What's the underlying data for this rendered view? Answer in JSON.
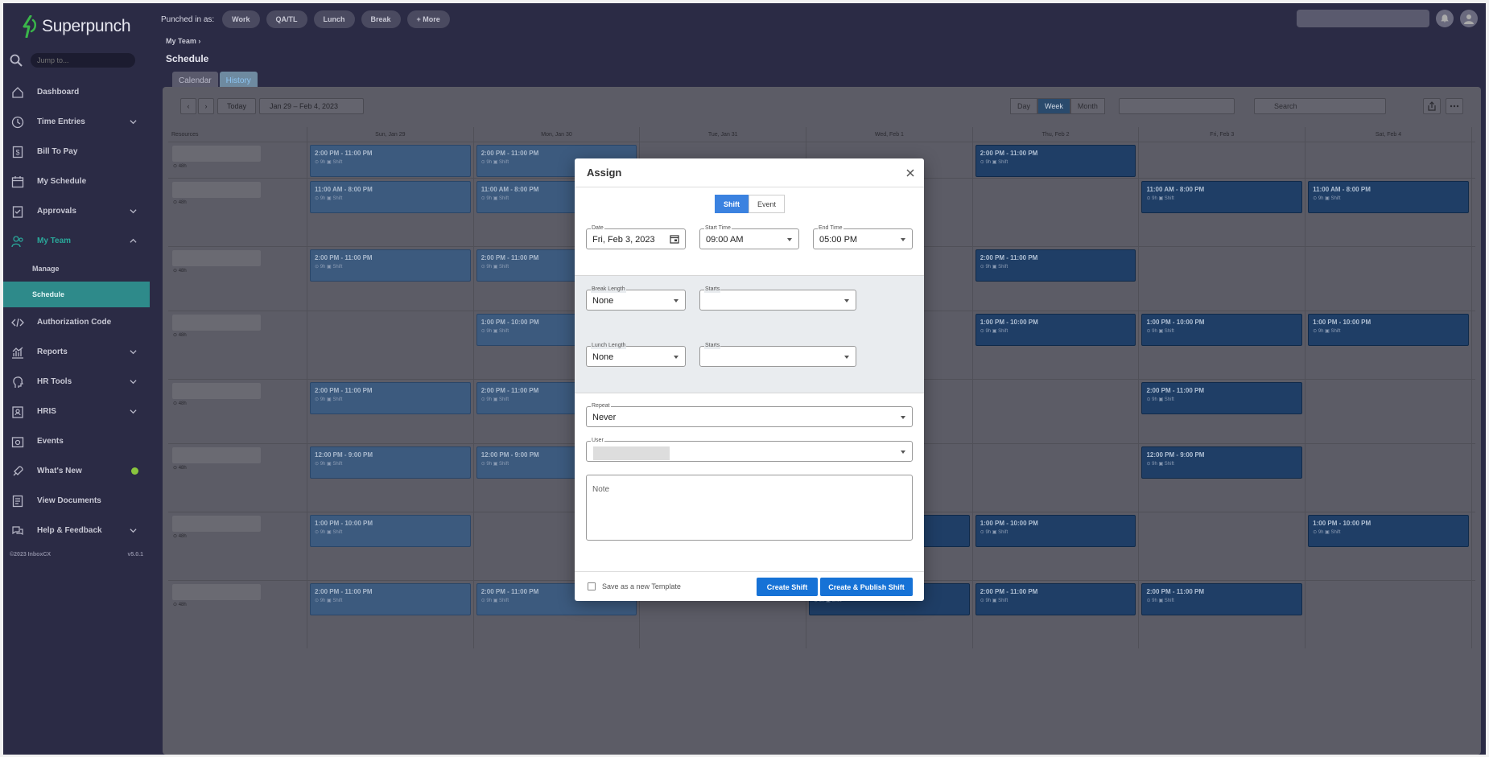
{
  "app": {
    "name": "Superpunch",
    "jump_placeholder": "Jump to..."
  },
  "nav": {
    "items": [
      {
        "label": "Dashboard"
      },
      {
        "label": "Time Entries"
      },
      {
        "label": "Bill To Pay"
      },
      {
        "label": "My Schedule"
      },
      {
        "label": "Approvals"
      },
      {
        "label": "My Team"
      },
      {
        "label": "Authorization Code"
      },
      {
        "label": "Reports"
      },
      {
        "label": "HR Tools"
      },
      {
        "label": "HRIS"
      },
      {
        "label": "Events"
      },
      {
        "label": "What's New"
      },
      {
        "label": "View Documents"
      },
      {
        "label": "Help & Feedback"
      }
    ],
    "subitems": [
      {
        "label": "Manage"
      },
      {
        "label": "Schedule"
      }
    ],
    "footer_copy": "©2023 InboxCX",
    "footer_version": "v5.0.1"
  },
  "topbar": {
    "punched_label": "Punched in as:",
    "pills": [
      "Work",
      "QA/TL",
      "Lunch",
      "Break",
      "+ More"
    ]
  },
  "page": {
    "breadcrumb": "My Team",
    "breadcrumb_sep": "›",
    "title": "Schedule",
    "tabs": [
      "Calendar",
      "History"
    ]
  },
  "toolbar": {
    "prev": "‹",
    "next": "›",
    "today": "Today",
    "range": "Jan 29 – Feb 4, 2023",
    "views": [
      "Day",
      "Week",
      "Month"
    ],
    "search_placeholder": "Search"
  },
  "grid": {
    "resources_label": "Resources",
    "days": [
      "Sun, Jan 29",
      "Mon, Jan 30",
      "Tue, Jan 31",
      "Wed, Feb 1",
      "Thu, Feb 2",
      "Fri, Feb 3",
      "Sat, Feb 4"
    ],
    "hours_label": "⊙ 48h",
    "shift_meta": "⊙ 9h   ▣ Shift",
    "rows": [
      [
        "2:00 PM - 11:00 PM",
        "2:00 PM - 11:00 PM",
        "",
        "",
        "2:00 PM - 11:00 PM",
        "",
        ""
      ],
      [
        "11:00 AM - 8:00 PM",
        "11:00 AM - 8:00 PM",
        "",
        "",
        "",
        "11:00 AM - 8:00 PM",
        "11:00 AM - 8:00 PM"
      ],
      [
        "2:00 PM - 11:00 PM",
        "2:00 PM - 11:00 PM",
        "",
        "",
        "2:00 PM - 11:00 PM",
        "",
        ""
      ],
      [
        "",
        "1:00 PM - 10:00 PM",
        "",
        "",
        "1:00 PM - 10:00 PM",
        "1:00 PM - 10:00 PM",
        "1:00 PM - 10:00 PM"
      ],
      [
        "2:00 PM - 11:00 PM",
        "2:00 PM - 11:00 PM",
        "",
        "",
        "",
        "2:00 PM - 11:00 PM",
        ""
      ],
      [
        "12:00 PM - 9:00 PM",
        "12:00 PM - 9:00 PM",
        "",
        "",
        "",
        "12:00 PM - 9:00 PM",
        ""
      ],
      [
        "1:00 PM - 10:00 PM",
        "",
        "1:00 PM - 10:00 PM",
        "1:00 PM - 10:00 PM",
        "1:00 PM - 10:00 PM",
        "",
        "1:00 PM - 10:00 PM"
      ],
      [
        "2:00 PM - 11:00 PM",
        "2:00 PM - 11:00 PM",
        "",
        "2:00 PM - 11:00 PM",
        "2:00 PM - 11:00 PM",
        "2:00 PM - 11:00 PM",
        ""
      ]
    ]
  },
  "modal": {
    "title": "Assign",
    "type_options": [
      "Shift",
      "Event"
    ],
    "date_label": "Date",
    "date_value": "Fri, Feb 3, 2023",
    "start_label": "Start Time",
    "start_value": "09:00 AM",
    "end_label": "End Time",
    "end_value": "05:00 PM",
    "break_label": "Break Length",
    "break_value": "None",
    "break_starts_label": "Starts",
    "lunch_label": "Lunch Length",
    "lunch_value": "None",
    "lunch_starts_label": "Starts",
    "repeat_label": "Repeat",
    "repeat_value": "Never",
    "user_label": "User",
    "note_placeholder": "Note",
    "template_label": "Save as a new Template",
    "create_label": "Create Shift",
    "publish_label": "Create & Publish Shift"
  }
}
